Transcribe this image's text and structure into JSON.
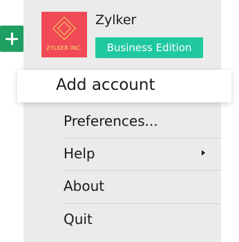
{
  "org": {
    "name": "Zylker",
    "logo_text": "ZYLKER INC.",
    "edition": "Business Edition"
  },
  "menu": {
    "add_account": "Add account",
    "preferences": "Preferences...",
    "help": "Help",
    "about": "About",
    "quit": "Quit"
  },
  "icons": {
    "add": "plus-icon",
    "submenu": "chevron-right-icon"
  },
  "colors": {
    "add_button": "#1f9f62",
    "edition_badge": "#1fc89e",
    "logo_bg": "#f04a56",
    "logo_accent": "#f2d85c",
    "panel_bg": "#ebebeb"
  }
}
